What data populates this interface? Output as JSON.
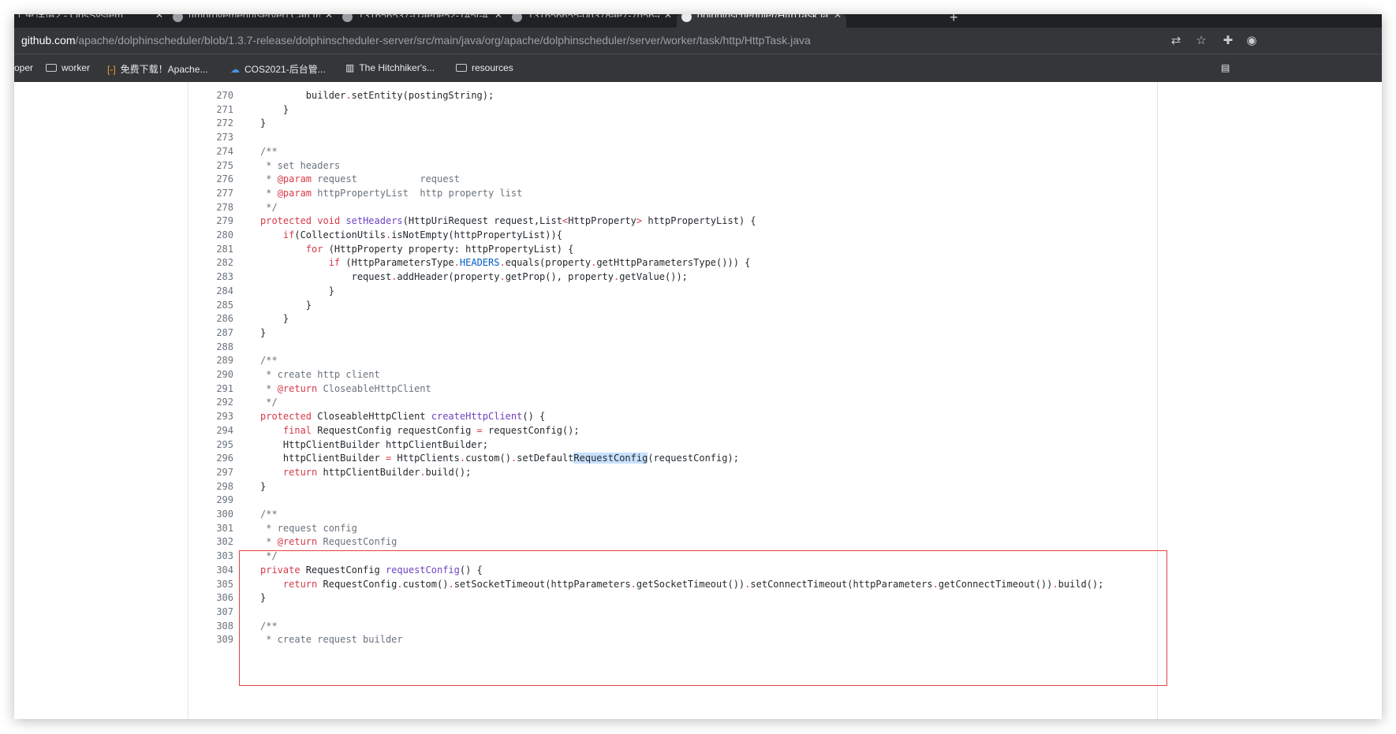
{
  "tabs": [
    {
      "label": "工单详情2 - OpsSystem"
    },
    {
      "label": "[Improvement][server] Can the"
    },
    {
      "label": "131656537-f1aebe52-145f-4"
    },
    {
      "label": "131656655-0d378ae7-7d56-4"
    },
    {
      "label": "dolphinscheduler/HttpTask.java"
    }
  ],
  "address_bar": {
    "host": "github.com",
    "path": "/apache/dolphinscheduler/blob/1.3.7-release/dolphinscheduler-server/src/main/java/org/apache/dolphinscheduler/server/worker/task/http/HttpTask.java"
  },
  "bookmarks": [
    {
      "label": "oper"
    },
    {
      "label": "worker"
    },
    {
      "label": "免费下载！Apache..."
    },
    {
      "label": "COS2021-后台管..."
    },
    {
      "label": "The Hitchhiker's..."
    },
    {
      "label": "resources"
    }
  ],
  "code_lines": [
    {
      "n": "270",
      "t": "        builder.setEntity(postingString);"
    },
    {
      "n": "271",
      "t": "    }"
    },
    {
      "n": "272",
      "t": "}"
    },
    {
      "n": "273",
      "t": ""
    },
    {
      "n": "274",
      "t": "/**"
    },
    {
      "n": "275",
      "t": " * set headers"
    },
    {
      "n": "276",
      "t": " * @param request           request"
    },
    {
      "n": "277",
      "t": " * @param httpPropertyList  http property list"
    },
    {
      "n": "278",
      "t": " */"
    },
    {
      "n": "279",
      "t": "protected void setHeaders(HttpUriRequest request,List<HttpProperty> httpPropertyList) {"
    },
    {
      "n": "280",
      "t": "    if(CollectionUtils.isNotEmpty(httpPropertyList)){"
    },
    {
      "n": "281",
      "t": "        for (HttpProperty property: httpPropertyList) {"
    },
    {
      "n": "282",
      "t": "            if (HttpParametersType.HEADERS.equals(property.getHttpParametersType())) {"
    },
    {
      "n": "283",
      "t": "                request.addHeader(property.getProp(), property.getValue());"
    },
    {
      "n": "284",
      "t": "            }"
    },
    {
      "n": "285",
      "t": "        }"
    },
    {
      "n": "286",
      "t": "    }"
    },
    {
      "n": "287",
      "t": "}"
    },
    {
      "n": "288",
      "t": ""
    },
    {
      "n": "289",
      "t": "/**"
    },
    {
      "n": "290",
      "t": " * create http client"
    },
    {
      "n": "291",
      "t": " * @return CloseableHttpClient"
    },
    {
      "n": "292",
      "t": " */"
    },
    {
      "n": "293",
      "t": "protected CloseableHttpClient createHttpClient() {"
    },
    {
      "n": "294",
      "t": "    final RequestConfig requestConfig = requestConfig();"
    },
    {
      "n": "295",
      "t": "    HttpClientBuilder httpClientBuilder;"
    },
    {
      "n": "296",
      "t": "    httpClientBuilder = HttpClients.custom().setDefaultRequestConfig(requestConfig);"
    },
    {
      "n": "297",
      "t": "    return httpClientBuilder.build();"
    },
    {
      "n": "298",
      "t": "}"
    },
    {
      "n": "299",
      "t": ""
    },
    {
      "n": "300",
      "t": "/**"
    },
    {
      "n": "301",
      "t": " * request config"
    },
    {
      "n": "302",
      "t": " * @return RequestConfig"
    },
    {
      "n": "303",
      "t": " */"
    },
    {
      "n": "304",
      "t": "private RequestConfig requestConfig() {"
    },
    {
      "n": "305",
      "t": "    return RequestConfig.custom().setSocketTimeout(httpParameters.getSocketTimeout()).setConnectTimeout(httpParameters.getConnectTimeout()).build();"
    },
    {
      "n": "306",
      "t": "}"
    },
    {
      "n": "307",
      "t": ""
    },
    {
      "n": "308",
      "t": "/**"
    },
    {
      "n": "309",
      "t": " * create request builder"
    }
  ],
  "highlighted_text": "RequestConfig",
  "colors": {
    "annotation_box": "#e5413f",
    "selection": "#c8e1ff",
    "keyword": "#d73a49",
    "function": "#6f42c1"
  }
}
